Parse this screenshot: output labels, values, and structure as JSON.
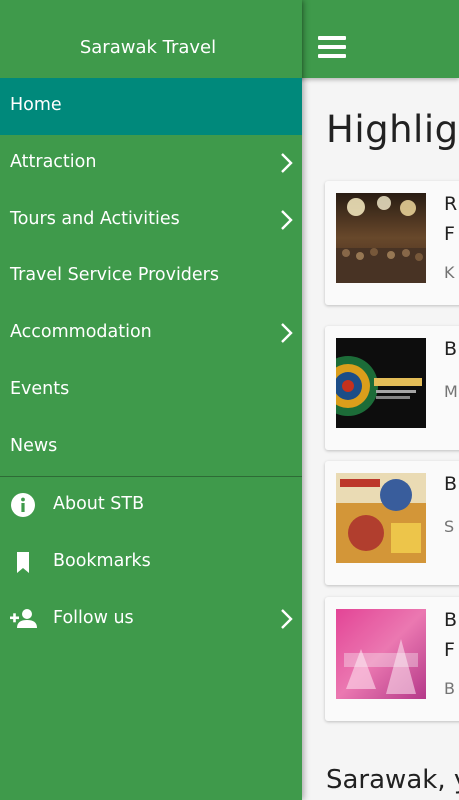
{
  "drawer": {
    "title": "Sarawak Travel",
    "items": [
      {
        "label": "Home",
        "active": true,
        "chevron": false
      },
      {
        "label": "Attraction",
        "chevron": true
      },
      {
        "label": "Tours and Activities",
        "chevron": true
      },
      {
        "label": "Travel Service Providers",
        "chevron": false
      },
      {
        "label": "Accommodation",
        "chevron": true
      },
      {
        "label": "Events",
        "chevron": false
      },
      {
        "label": "News",
        "chevron": false
      }
    ],
    "secondary": [
      {
        "label": "About STB",
        "icon": "info-icon"
      },
      {
        "label": "Bookmarks",
        "icon": "bookmark-icon"
      },
      {
        "label": "Follow us",
        "icon": "add-person-icon",
        "chevron": true
      }
    ]
  },
  "main": {
    "menu_icon": "hamburger-menu-icon",
    "section_title": "Highlig",
    "cards": [
      {
        "line1": "R",
        "line2": "F",
        "location": "K"
      },
      {
        "line1": "B",
        "line2": "",
        "location": "M"
      },
      {
        "line1": "B",
        "line2": "",
        "location": "S"
      },
      {
        "line1": "B",
        "line2": "F",
        "location": "B"
      }
    ],
    "bottom_title": "Sarawak, y"
  },
  "colors": {
    "primary": "#3f9a4b",
    "active_item": "#00897b",
    "background": "#fafafa"
  }
}
